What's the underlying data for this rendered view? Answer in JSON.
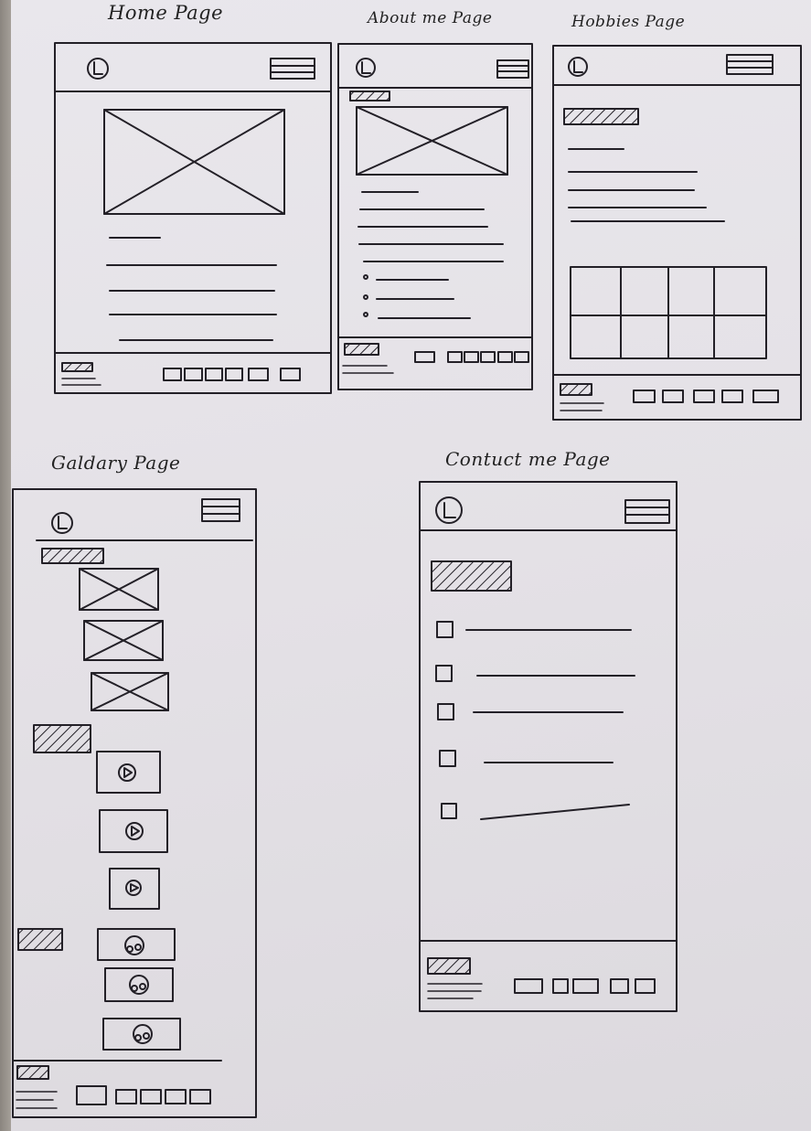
{
  "pages": [
    {
      "id": "home",
      "title": "Home Page"
    },
    {
      "id": "about",
      "title": "About me Page"
    },
    {
      "id": "hobbies",
      "title": "Hobbies Page"
    },
    {
      "id": "gallery",
      "title": "Galdary Page"
    },
    {
      "id": "contact",
      "title": "Contuct me Page"
    }
  ],
  "icons": {
    "logo": "logo-circle-icon",
    "menu": "hamburger-menu-icon",
    "image": "image-placeholder-icon",
    "video": "video-play-icon",
    "audio": "audio-icon",
    "checkbox": "checkbox-icon",
    "heading": "hatched-heading-block"
  },
  "colors": {
    "ink": "#232027",
    "paper": "#e6e3e8"
  }
}
